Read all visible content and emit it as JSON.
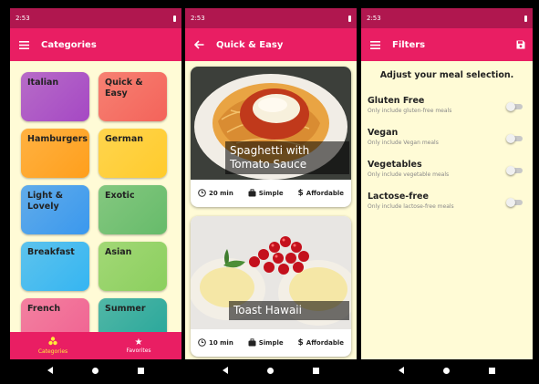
{
  "status_time": "2:53",
  "screen1": {
    "title": "Categories",
    "categories": [
      {
        "label": "Italian",
        "color": "#a548c4"
      },
      {
        "label": "Quick & Easy",
        "color": "#f4635a"
      },
      {
        "label": "Hamburgers",
        "color": "#ff9f1c"
      },
      {
        "label": "German",
        "color": "#ffcb2c"
      },
      {
        "label": "Light & Lovely",
        "color": "#3a98ee"
      },
      {
        "label": "Exotic",
        "color": "#66bb6a"
      },
      {
        "label": "Breakfast",
        "color": "#35b5f2"
      },
      {
        "label": "Asian",
        "color": "#8bcf5e"
      },
      {
        "label": "French",
        "color": "#f06292"
      },
      {
        "label": "Summer",
        "color": "#26a69a"
      }
    ],
    "bottom_nav": {
      "categories": "Categories",
      "favorites": "Favorites"
    }
  },
  "screen2": {
    "title": "Quick & Easy",
    "meals": [
      {
        "title": "Spaghetti with Tomato Sauce",
        "duration": "20 min",
        "complexity": "Simple",
        "affordability": "Affordable"
      },
      {
        "title": "Toast Hawaii",
        "duration": "10 min",
        "complexity": "Simple",
        "affordability": "Affordable"
      }
    ]
  },
  "screen3": {
    "title": "Filters",
    "heading": "Adjust your meal selection.",
    "filters": [
      {
        "title": "Gluten Free",
        "subtitle": "Only include gluten-free meals"
      },
      {
        "title": "Vegan",
        "subtitle": "Only include Vegan meals"
      },
      {
        "title": "Vegetables",
        "subtitle": "Only include vegetable meals"
      },
      {
        "title": "Lactose-free",
        "subtitle": "Only include lactose-free meals"
      }
    ]
  },
  "colors": {
    "primary": "#e91e63",
    "status": "#b0174f",
    "background": "#fffbd6",
    "accent": "#ffeb3b"
  },
  "icons": [
    "menu-icon",
    "back-arrow-icon",
    "save-icon",
    "clock-icon",
    "briefcase-icon",
    "dollar-icon",
    "categories-icon",
    "star-icon"
  ]
}
